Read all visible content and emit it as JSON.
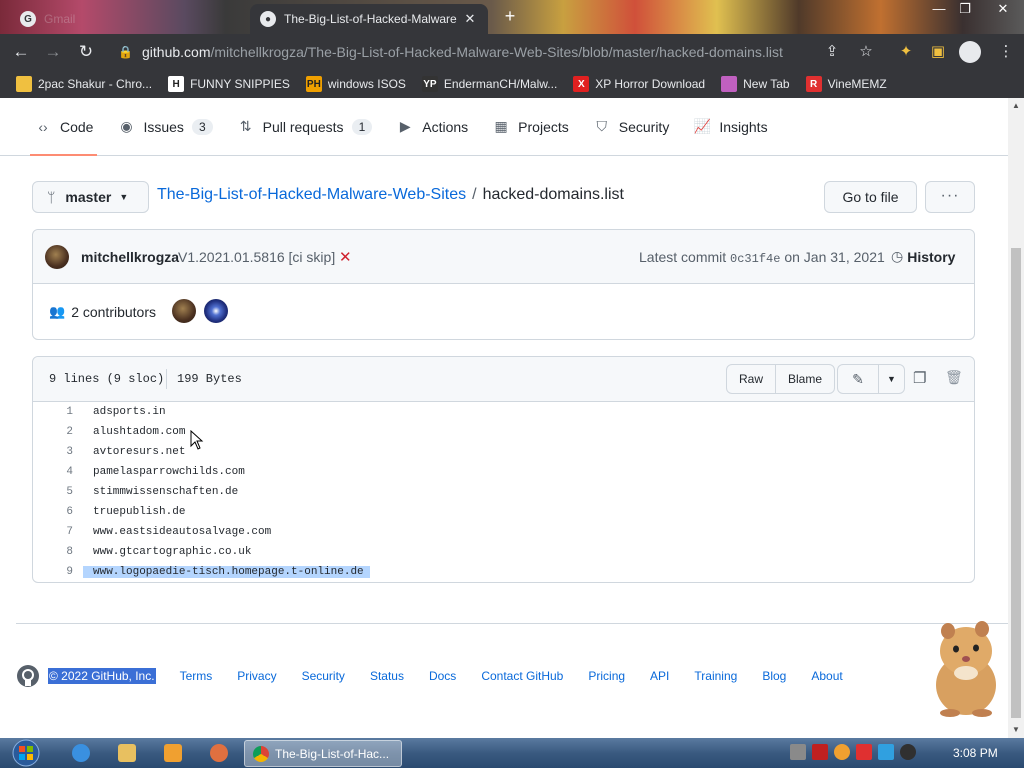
{
  "browser": {
    "inactive_tab": "Gmail",
    "active_tab": "The-Big-List-of-Hacked-Malware",
    "url_host": "github.com",
    "url_path": "/mitchellkrogza/The-Big-List-of-Hacked-Malware-Web-Sites/blob/master/hacked-domains.list",
    "bookmarks": [
      {
        "label": "2pac Shakur - Chro...",
        "icon": "H-icon",
        "color": "#f0c040"
      },
      {
        "label": "FUNNY SNIPPIES",
        "icon": "H",
        "color": "#ffffff"
      },
      {
        "label": "windows ISOS",
        "icon": "PH",
        "color": "#f0a000"
      },
      {
        "label": "EndermanCH/Malw...",
        "icon": "YP",
        "color": "#333333"
      },
      {
        "label": "XP Horror Download",
        "icon": "X",
        "color": "#e02020"
      },
      {
        "label": "New Tab",
        "icon": "globe",
        "color": "#c060c0"
      },
      {
        "label": "VineMEMZ",
        "icon": "R",
        "color": "#e03030"
      }
    ]
  },
  "repo_nav": [
    {
      "label": "Code",
      "icon": "code-icon",
      "count": null,
      "selected": true
    },
    {
      "label": "Issues",
      "icon": "issue-icon",
      "count": "3"
    },
    {
      "label": "Pull requests",
      "icon": "pull-request-icon",
      "count": "1"
    },
    {
      "label": "Actions",
      "icon": "play-icon",
      "count": null
    },
    {
      "label": "Projects",
      "icon": "table-icon",
      "count": null
    },
    {
      "label": "Security",
      "icon": "shield-icon",
      "count": null
    },
    {
      "label": "Insights",
      "icon": "graph-icon",
      "count": null
    }
  ],
  "branch": "master",
  "breadcrumb": {
    "repo": "The-Big-List-of-Hacked-Malware-Web-Sites",
    "separator": "/",
    "file": "hacked-domains.list"
  },
  "go_to_file": "Go to file",
  "commit": {
    "author": "mitchellkrogza",
    "message": "V1.2021.01.5816 [ci skip]",
    "status": "✕",
    "latest_label": "Latest commit",
    "sha": "0c31f4e",
    "date": "on Jan 31, 2021",
    "history": "History"
  },
  "contributors": "2 contributors",
  "file": {
    "lines_info": "9 lines (9 sloc)",
    "size": "199 Bytes",
    "raw": "Raw",
    "blame": "Blame",
    "lines": [
      {
        "n": "1",
        "text": "adsports.in"
      },
      {
        "n": "2",
        "text": "alushtadom.com"
      },
      {
        "n": "3",
        "text": "avtoresurs.net"
      },
      {
        "n": "4",
        "text": "pamelasparrowchilds.com"
      },
      {
        "n": "5",
        "text": "stimmwissenschaften.de"
      },
      {
        "n": "6",
        "text": "truepublish.de"
      },
      {
        "n": "7",
        "text": "www.eastsideautosalvage.com"
      },
      {
        "n": "8",
        "text": "www.gtcartographic.co.uk"
      },
      {
        "n": "9",
        "text": "www.logopaedie-tisch.homepage.t-online.de"
      }
    ]
  },
  "footer": {
    "copyright": "© 2022 GitHub, Inc.",
    "links": [
      "Terms",
      "Privacy",
      "Security",
      "Status",
      "Docs",
      "Contact GitHub",
      "Pricing",
      "API",
      "Training",
      "Blog",
      "About"
    ]
  },
  "taskbar": {
    "task": "The-Big-List-of-Hac...",
    "clock": "3:08 PM"
  }
}
